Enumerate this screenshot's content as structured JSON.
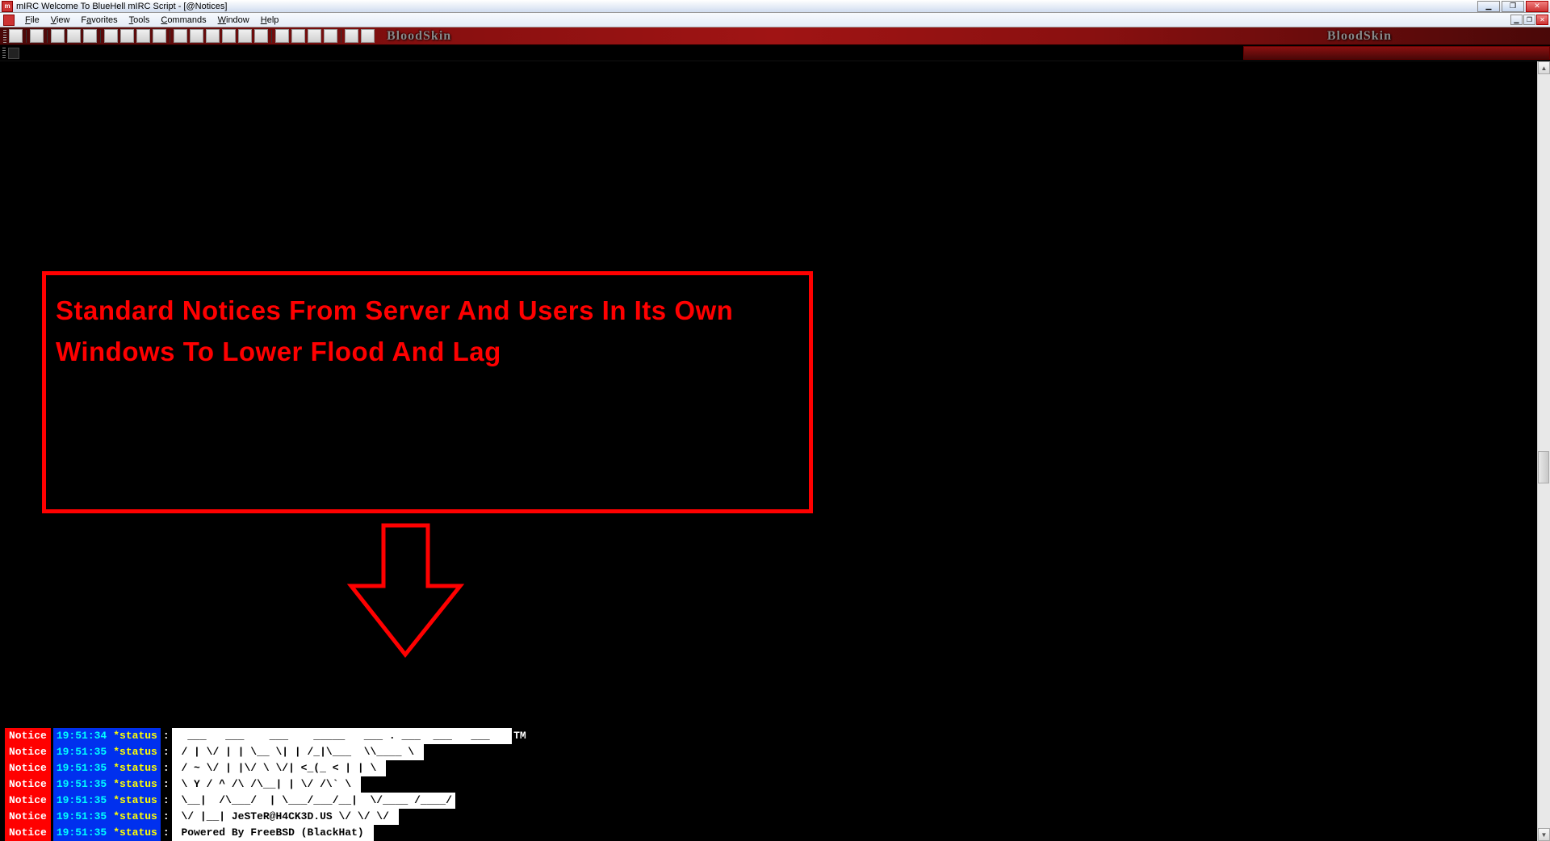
{
  "titlebar": {
    "text": "mIRC Welcome To BlueHell mIRC Script - [@Notices]"
  },
  "menubar": {
    "items": [
      "File",
      "View",
      "Favorites",
      "Tools",
      "Commands",
      "Window",
      "Help"
    ]
  },
  "toolbar": {
    "brand": "BloodSkin"
  },
  "annotation": {
    "text": "Standard Notices From Server And Users In Its Own Windows To Lower Flood And Lag"
  },
  "notices": [
    {
      "label": "Notice",
      "time": "19:51:34",
      "status": "*status",
      "msg": "  ___   ___    ___    _____   ___ . ___  ___   ___   ",
      "suffix": "TM"
    },
    {
      "label": "Notice",
      "time": "19:51:35",
      "status": "*status",
      "msg": " / | \\/ | | \\__ \\| | /_|\\___  \\\\____ \\ ",
      "suffix": ""
    },
    {
      "label": "Notice",
      "time": "19:51:35",
      "status": "*status",
      "msg": " / ~ \\/ | |\\/ \\ \\/| <_(_ < | | \\ ",
      "suffix": ""
    },
    {
      "label": "Notice",
      "time": "19:51:35",
      "status": "*status",
      "msg": " \\ Y / ^ /\\ /\\__| | \\/ /\\` \\ ",
      "suffix": ""
    },
    {
      "label": "Notice",
      "time": "19:51:35",
      "status": "*status",
      "msg": " \\__|  /\\___/  | \\___/___/__|  \\/____ /____/",
      "suffix": ""
    },
    {
      "label": "Notice",
      "time": "19:51:35",
      "status": "*status",
      "msg": " \\/ |__| JeSTeR@H4CK3D.US \\/ \\/ \\/ ",
      "suffix": ""
    },
    {
      "label": "Notice",
      "time": "19:51:35",
      "status": "*status",
      "msg": " Powered By FreeBSD (BlackHat) ",
      "suffix": ""
    }
  ]
}
